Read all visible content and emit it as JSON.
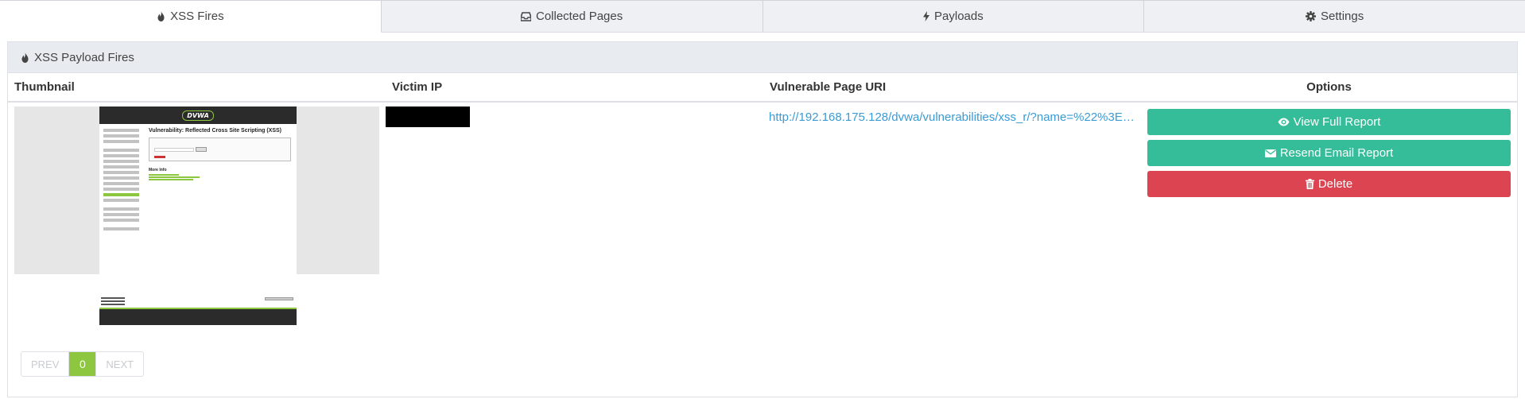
{
  "tabs": [
    {
      "label": "XSS Fires",
      "icon": "fire-icon",
      "active": true
    },
    {
      "label": "Collected Pages",
      "icon": "inbox-icon",
      "active": false
    },
    {
      "label": "Payloads",
      "icon": "bolt-icon",
      "active": false
    },
    {
      "label": "Settings",
      "icon": "gear-icon",
      "active": false
    }
  ],
  "panel": {
    "title": "XSS Payload Fires",
    "icon": "fire-icon"
  },
  "table": {
    "headers": [
      "Thumbnail",
      "Victim IP",
      "Vulnerable Page URI",
      "Options"
    ],
    "rows": [
      {
        "thumbnail": {
          "logo": "DVWA",
          "title": "Vulnerability: Reflected Cross Site Scripting (XSS)",
          "more_info": "More Info"
        },
        "victim_ip": "",
        "uri": "http://192.168.175.128/dvwa/vulnerabilities/xss_r/?name=%22%3E%..."
      }
    ]
  },
  "options": {
    "view_full_report": "View Full Report",
    "resend_email_report": "Resend Email Report",
    "delete": "Delete"
  },
  "pagination": {
    "prev": "PREV",
    "current": "0",
    "next": "NEXT"
  },
  "colors": {
    "teal": "#35bc99",
    "red": "#dc4451",
    "green": "#8dc63f",
    "link": "#3a9bd5"
  }
}
